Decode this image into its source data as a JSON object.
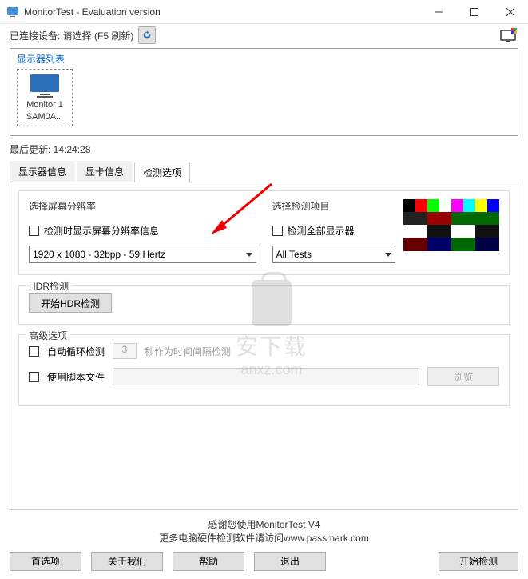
{
  "window": {
    "title": "MonitorTest - Evaluation version"
  },
  "toolbar": {
    "device_label": "已连接设备: 请选择 (F5 刷新)"
  },
  "monitor_list": {
    "title": "显示器列表",
    "items": [
      {
        "line1": "Monitor 1",
        "line2": "SAM0A..."
      }
    ]
  },
  "last_update": "最后更新: 14:24:28",
  "tabs": [
    {
      "label": "显示器信息",
      "active": false
    },
    {
      "label": "显卡信息",
      "active": false
    },
    {
      "label": "检测选项",
      "active": true
    }
  ],
  "resolution_section": {
    "title": "选择屏幕分辨率",
    "checkbox_label": "检测时显示屏幕分辨率信息",
    "selected": "1920 x 1080 - 32bpp - 59 Hertz"
  },
  "test_items_section": {
    "title": "选择检测项目",
    "checkbox_label": "检测全部显示器",
    "selected": "All Tests"
  },
  "hdr_section": {
    "title": "HDR检测",
    "button": "开始HDR检测"
  },
  "advanced_section": {
    "title": "高级选项",
    "auto_loop_label": "自动循环检测",
    "interval_value": "3",
    "interval_suffix": "秒作为时间间隔检测",
    "script_label": "使用脚本文件",
    "browse": "浏览"
  },
  "footer": {
    "line1": "感谢您使用MonitorTest V4",
    "line2": "更多电脑硬件检测软件请访问www.passmark.com"
  },
  "buttons": {
    "preferences": "首选项",
    "about": "关于我们",
    "help": "帮助",
    "exit": "退出",
    "start": "开始检测"
  },
  "watermark": {
    "text": "安下载",
    "url": "anxz.com"
  }
}
